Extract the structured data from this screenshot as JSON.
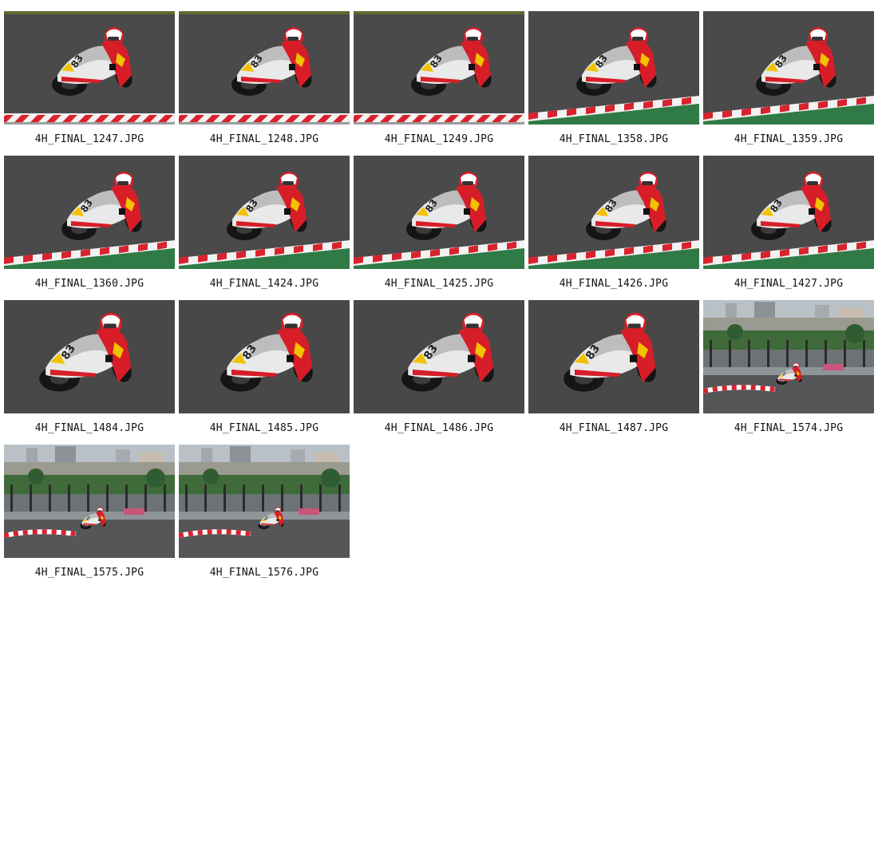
{
  "gallery": {
    "items": [
      {
        "filename": "4H_FINAL_1247.JPG",
        "scene": "closeup-curb-bottom",
        "variant": 1
      },
      {
        "filename": "4H_FINAL_1248.JPG",
        "scene": "closeup-curb-bottom",
        "variant": 2
      },
      {
        "filename": "4H_FINAL_1249.JPG",
        "scene": "closeup-curb-bottom",
        "variant": 3
      },
      {
        "filename": "4H_FINAL_1358.JPG",
        "scene": "closeup-curb-grass",
        "variant": 1
      },
      {
        "filename": "4H_FINAL_1359.JPG",
        "scene": "closeup-curb-grass",
        "variant": 2
      },
      {
        "filename": "4H_FINAL_1360.JPG",
        "scene": "closeup-curb-grass",
        "variant": 3
      },
      {
        "filename": "4H_FINAL_1424.JPG",
        "scene": "closeup-curb-grass",
        "variant": 1
      },
      {
        "filename": "4H_FINAL_1425.JPG",
        "scene": "closeup-curb-grass",
        "variant": 2
      },
      {
        "filename": "4H_FINAL_1426.JPG",
        "scene": "closeup-curb-grass",
        "variant": 3
      },
      {
        "filename": "4H_FINAL_1427.JPG",
        "scene": "closeup-curb-grass",
        "variant": 1
      },
      {
        "filename": "4H_FINAL_1484.JPG",
        "scene": "closeup-asphalt",
        "variant": 1
      },
      {
        "filename": "4H_FINAL_1485.JPG",
        "scene": "closeup-asphalt",
        "variant": 2
      },
      {
        "filename": "4H_FINAL_1486.JPG",
        "scene": "closeup-asphalt",
        "variant": 3
      },
      {
        "filename": "4H_FINAL_1487.JPG",
        "scene": "closeup-asphalt",
        "variant": 1
      },
      {
        "filename": "4H_FINAL_1574.JPG",
        "scene": "wide-city",
        "variant": 1
      },
      {
        "filename": "4H_FINAL_1575.JPG",
        "scene": "wide-city",
        "variant": 2
      },
      {
        "filename": "4H_FINAL_1576.JPG",
        "scene": "wide-city",
        "variant": 3
      }
    ]
  },
  "colors": {
    "page_background": "#ffffff",
    "caption_text": "#111111",
    "asphalt": "#4a4a4a",
    "curb_red": "#d8232e",
    "curb_white": "#f2f2f2",
    "grass": "#2f7a45",
    "bike_white": "#e9e9e9",
    "rider_red": "#d71e28",
    "accent_yellow": "#f2c200"
  }
}
